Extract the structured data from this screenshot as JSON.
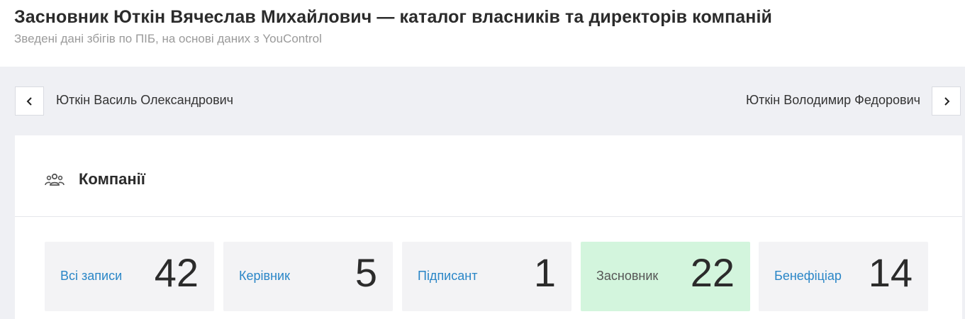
{
  "header": {
    "title": "Засновник Юткін Вячеслав Михайлович — каталог власників та директорів компаній",
    "subtitle": "Зведені дані збігів по ПІБ, на основі даних з YouControl"
  },
  "navigation": {
    "prev_name": "Юткін Василь Олександрович",
    "next_name": "Юткін Володимир Федорович",
    "prev_icon": "chevron-left-icon",
    "next_icon": "chevron-right-icon"
  },
  "companies": {
    "title": "Компанії",
    "icon": "people-group-icon",
    "stats": [
      {
        "label": "Всі записи",
        "count": "42",
        "active": false
      },
      {
        "label": "Керівник",
        "count": "5",
        "active": false
      },
      {
        "label": "Підписант",
        "count": "1",
        "active": false
      },
      {
        "label": "Засновник",
        "count": "22",
        "active": true
      },
      {
        "label": "Бенефіціар",
        "count": "14",
        "active": false
      }
    ]
  },
  "colors": {
    "link": "#2a86c7",
    "active_bg": "#d3f5dd",
    "page_bg": "#eff0f4"
  }
}
